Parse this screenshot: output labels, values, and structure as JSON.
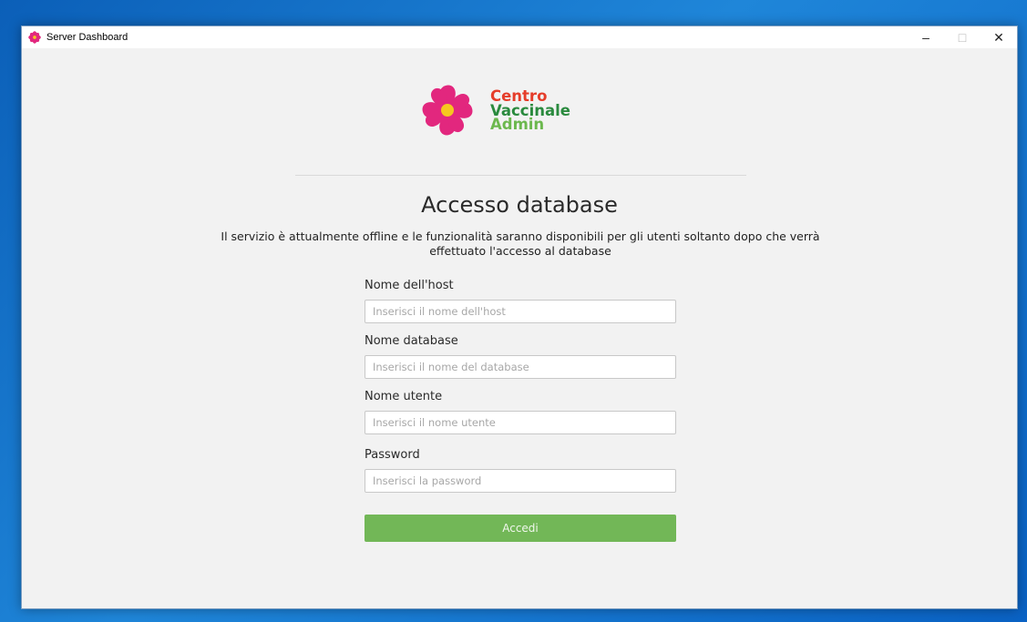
{
  "window": {
    "title": "Server Dashboard",
    "icon": "flower-icon",
    "controls": {
      "minimize": "–",
      "maximize": "□",
      "close": "✕"
    }
  },
  "logo": {
    "line1": "Centro",
    "line2": "Vaccinale",
    "line3": "Admin",
    "colors": {
      "petals": "#e2277e",
      "center": "#f6c71f",
      "line1": "#e53d2a",
      "line2": "#2a8a3e",
      "line3": "#6cb84e"
    }
  },
  "heading": "Accesso database",
  "subtitle": "Il servizio è attualmente offline e le funzionalità saranno disponibili per gli utenti soltanto dopo che verrà effettuato l'accesso al database",
  "form": {
    "host": {
      "label": "Nome dell'host",
      "placeholder": "Inserisci il nome dell'host",
      "value": ""
    },
    "database": {
      "label": "Nome database",
      "placeholder": "Inserisci il nome del database",
      "value": ""
    },
    "username": {
      "label": "Nome utente",
      "placeholder": "Inserisci il nome utente",
      "value": ""
    },
    "password": {
      "label": "Password",
      "placeholder": "Inserisci la password",
      "value": ""
    },
    "submit_label": "Accedi"
  },
  "colors": {
    "accent": "#72b757",
    "background": "#f2f2f2"
  }
}
